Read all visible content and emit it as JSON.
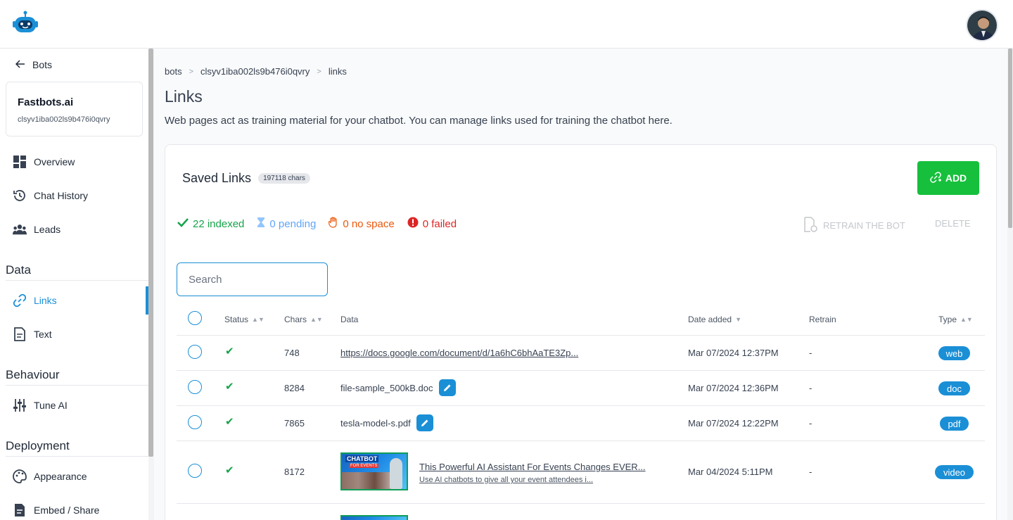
{
  "colors": {
    "accent": "#1a8fd6",
    "add_green": "#16c03c",
    "indexed": "#16a34a",
    "pending": "#60a5fa",
    "no_space": "#ea580c",
    "failed": "#dc2626"
  },
  "sidebar": {
    "back_label": "Bots",
    "bot": {
      "name": "Fastbots.ai",
      "id": "clsyv1iba002ls9b476i0qvry"
    },
    "items": [
      {
        "label": "Overview",
        "icon": "grid-icon"
      },
      {
        "label": "Chat History",
        "icon": "history-icon"
      },
      {
        "label": "Leads",
        "icon": "users-icon"
      }
    ],
    "sections": {
      "data": {
        "title": "Data",
        "items": [
          {
            "label": "Links",
            "icon": "link-icon"
          },
          {
            "label": "Text",
            "icon": "document-icon"
          }
        ]
      },
      "behaviour": {
        "title": "Behaviour",
        "items": [
          {
            "label": "Tune AI",
            "icon": "sliders-icon"
          }
        ]
      },
      "deployment": {
        "title": "Deployment",
        "items": [
          {
            "label": "Appearance",
            "icon": "palette-icon"
          },
          {
            "label": "Embed / Share",
            "icon": "embed-icon"
          }
        ]
      }
    }
  },
  "breadcrumb": [
    "bots",
    "clsyv1iba002ls9b476i0qvry",
    "links"
  ],
  "page": {
    "title": "Links",
    "description": "Web pages act as training material for your chatbot. You can manage links used for training the chatbot here."
  },
  "saved_links": {
    "title": "Saved Links",
    "chars_badge": "197118 chars",
    "add_label": "ADD",
    "stats": {
      "indexed": "22 indexed",
      "pending": "0 pending",
      "no_space": "0 no space",
      "failed": "0 failed"
    },
    "retrain_label": "RETRAIN THE BOT",
    "delete_label": "DELETE",
    "search_placeholder": "Search"
  },
  "table": {
    "headers": {
      "status": "Status",
      "chars": "Chars",
      "data": "Data",
      "date": "Date added",
      "retrain": "Retrain",
      "type": "Type"
    },
    "rows": [
      {
        "chars": "748",
        "data": "https://docs.google.com/document/d/1a6hC6bhAaTE3Zp...",
        "date": "Mar 07/2024 12:37PM",
        "retrain": "-",
        "type": "web"
      },
      {
        "chars": "8284",
        "data": "file-sample_500kB.doc",
        "date": "Mar 07/2024 12:36PM",
        "retrain": "-",
        "type": "doc"
      },
      {
        "chars": "7865",
        "data": "tesla-model-s.pdf",
        "date": "Mar 07/2024 12:22PM",
        "retrain": "-",
        "type": "pdf"
      },
      {
        "chars": "8172",
        "data": "This Powerful AI Assistant For Events Changes EVER...",
        "subtitle": "Use AI chatbots to give all your event attendees i...",
        "thumb_text": "CHATBOT",
        "thumb_sub": "FOR EVENTS",
        "date": "Mar 04/2024 5:11PM",
        "retrain": "-",
        "type": "video"
      }
    ]
  }
}
